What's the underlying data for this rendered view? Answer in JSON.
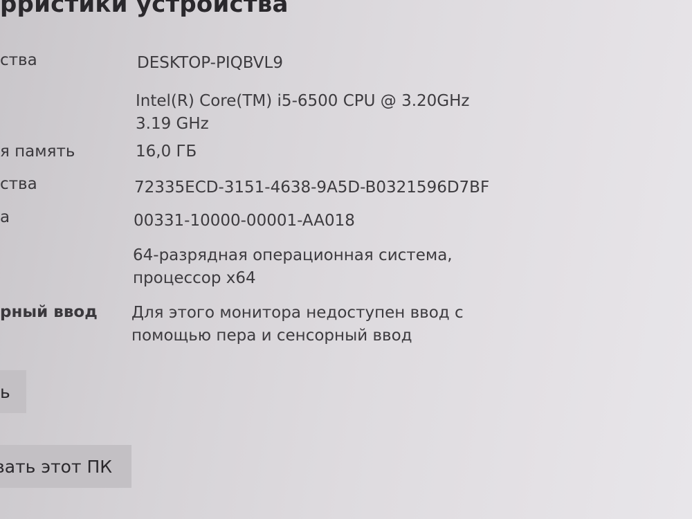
{
  "page": {
    "title": "рристики устройства"
  },
  "specs": [
    {
      "label": "ства",
      "value_lines": [
        "DESKTOP-PIQBVL9"
      ]
    },
    {
      "label": "",
      "value_lines": [
        "Intel(R) Core(TM) i5-6500 CPU @ 3.20GHz",
        "3.19 GHz"
      ]
    },
    {
      "label": "я память",
      "value_lines": [
        "16,0 ГБ"
      ]
    },
    {
      "label": "ства",
      "value_lines": [
        "72335ECD-3151-4638-9A5D-B0321596D7BF"
      ]
    },
    {
      "label": "а",
      "value_lines": [
        "00331-10000-00001-AA018"
      ]
    },
    {
      "label": "",
      "value_lines": [
        "64-разрядная операционная система,",
        "процессор x64"
      ]
    },
    {
      "label": "рный ввод",
      "value_lines": [
        "Для этого монитора недоступен ввод с",
        "помощью пера и сенсорный ввод"
      ]
    }
  ],
  "buttons": {
    "copy_label": "ь",
    "rename_label": "овать этот ПК"
  }
}
